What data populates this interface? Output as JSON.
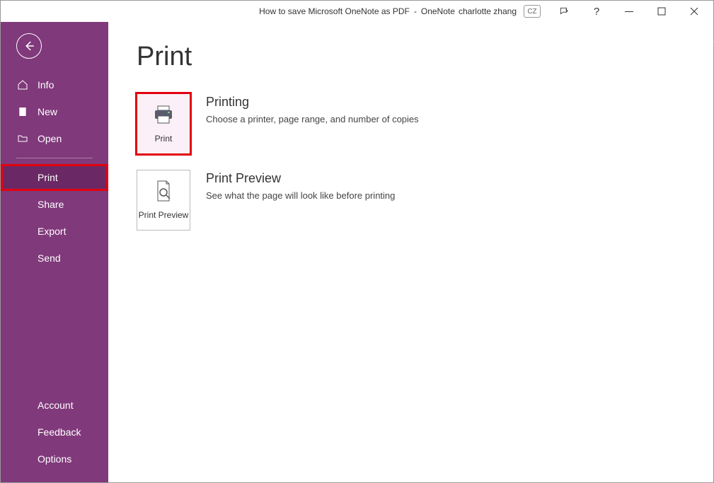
{
  "titlebar": {
    "doc_title": "How to save Microsoft OneNote as PDF",
    "sep": "-",
    "app_name": "OneNote",
    "user": "charlotte zhang",
    "user_initials": "CZ",
    "help": "?"
  },
  "sidebar": {
    "info": "Info",
    "new": "New",
    "open": "Open",
    "print": "Print",
    "share": "Share",
    "export": "Export",
    "send": "Send",
    "account": "Account",
    "feedback": "Feedback",
    "options": "Options"
  },
  "main": {
    "title": "Print",
    "print": {
      "tile": "Print",
      "heading": "Printing",
      "desc": "Choose a printer, page range, and number of copies"
    },
    "preview": {
      "tile": "Print Preview",
      "heading": "Print Preview",
      "desc": "See what the page will look like before printing"
    }
  }
}
